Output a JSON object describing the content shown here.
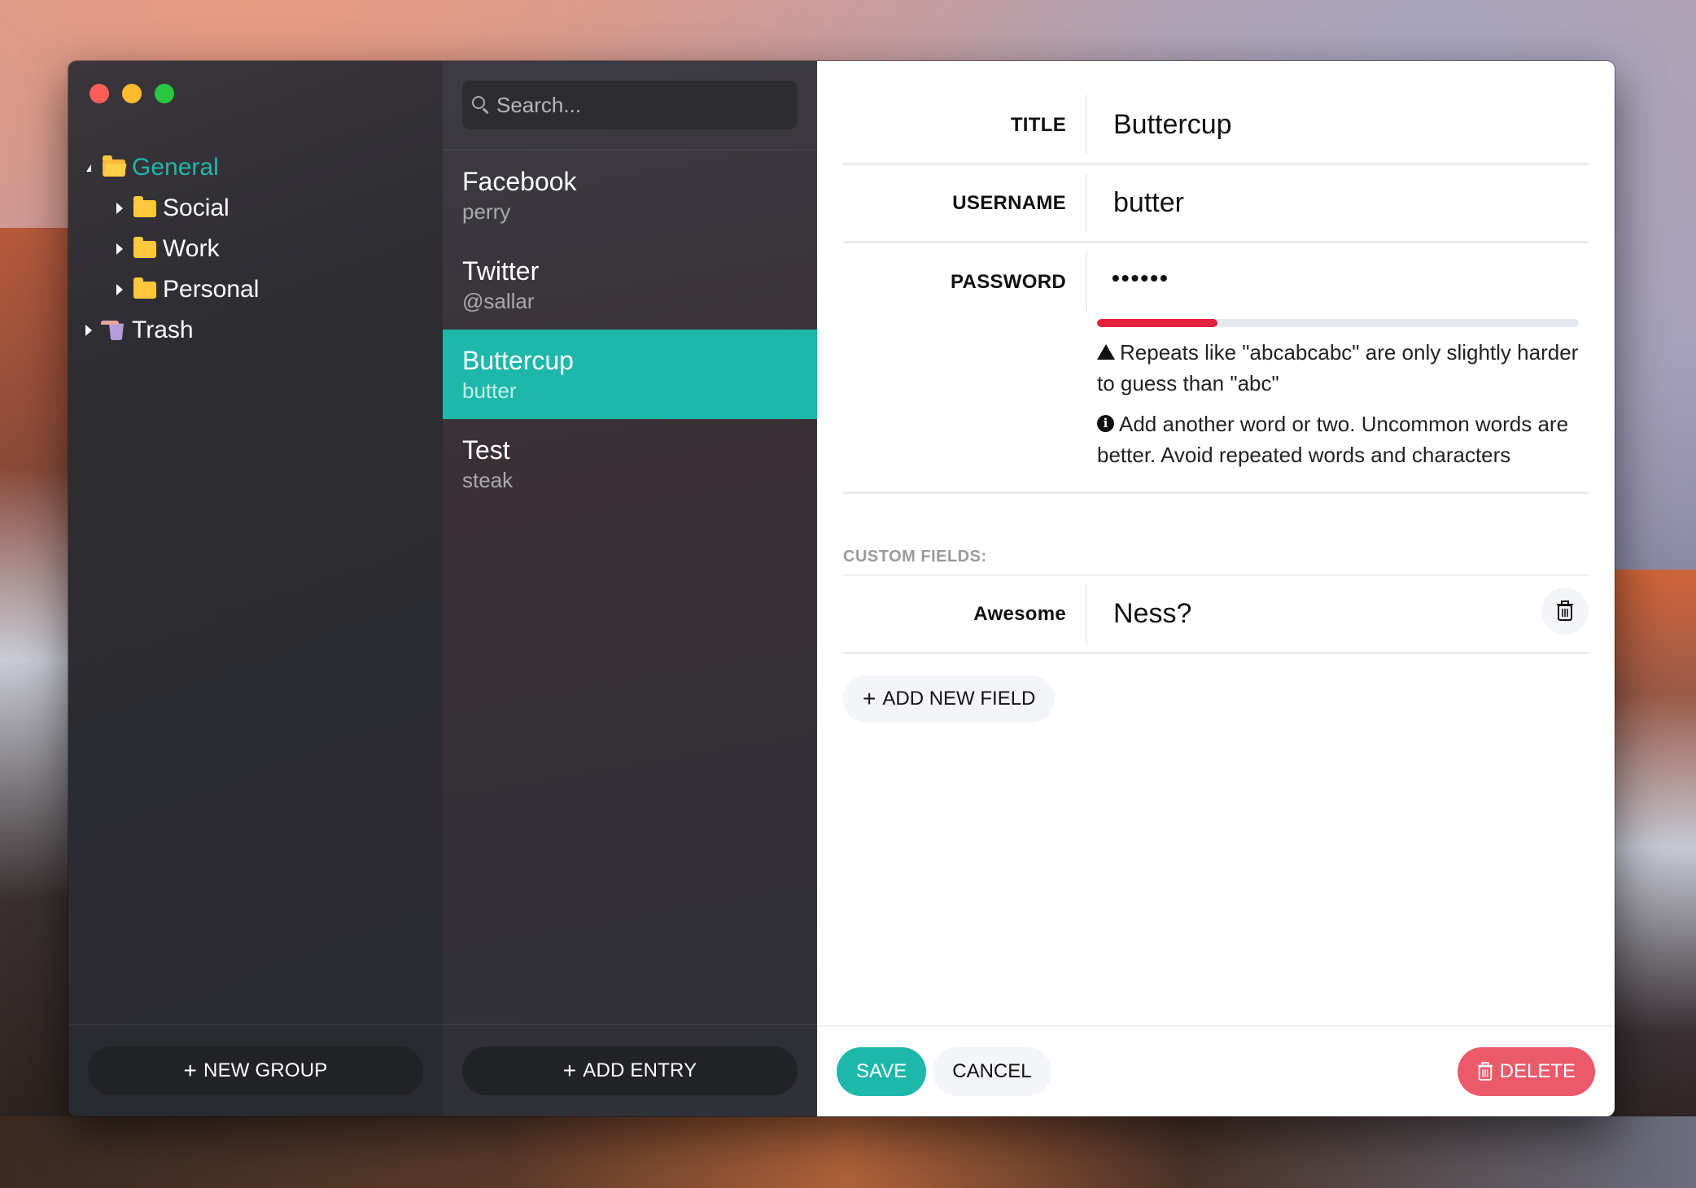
{
  "window": {
    "traffic_lights": [
      "close",
      "minimize",
      "maximize"
    ]
  },
  "sidebar": {
    "groups": [
      {
        "label": "General",
        "icon": "folder-open-icon",
        "expanded": true,
        "active": true
      },
      {
        "label": "Social",
        "icon": "folder-icon",
        "expanded": false
      },
      {
        "label": "Work",
        "icon": "folder-icon",
        "expanded": false
      },
      {
        "label": "Personal",
        "icon": "folder-icon",
        "expanded": false
      },
      {
        "label": "Trash",
        "icon": "trash-icon",
        "expanded": false
      }
    ],
    "new_group_label": "NEW GROUP"
  },
  "entries": {
    "search_placeholder": "Search...",
    "items": [
      {
        "title": "Facebook",
        "subtitle": "perry"
      },
      {
        "title": "Twitter",
        "subtitle": "@sallar"
      },
      {
        "title": "Buttercup",
        "subtitle": "butter",
        "selected": true
      },
      {
        "title": "Test",
        "subtitle": "steak"
      }
    ],
    "add_entry_label": "ADD ENTRY"
  },
  "detail": {
    "fields": {
      "title": {
        "label": "TITLE",
        "value": "Buttercup"
      },
      "username": {
        "label": "USERNAME",
        "value": "butter"
      },
      "password": {
        "label": "PASSWORD",
        "value": "••••••"
      }
    },
    "password_strength": {
      "fraction": 0.25,
      "color": "#e4213f",
      "warning": "Repeats like \"abcabcabc\" are only slightly harder to guess than \"abc\"",
      "suggestion": "Add another word or two. Uncommon words are better. Avoid repeated words and characters"
    },
    "custom_fields_label": "CUSTOM FIELDS:",
    "custom_fields": [
      {
        "label": "Awesome",
        "value": "Ness?"
      }
    ],
    "add_field_label": "ADD NEW FIELD",
    "save_label": "SAVE",
    "cancel_label": "CANCEL",
    "delete_label": "DELETE"
  },
  "colors": {
    "accent": "#1eb8aa",
    "danger": "#ea5a6b",
    "folder": "#ffc83d"
  }
}
